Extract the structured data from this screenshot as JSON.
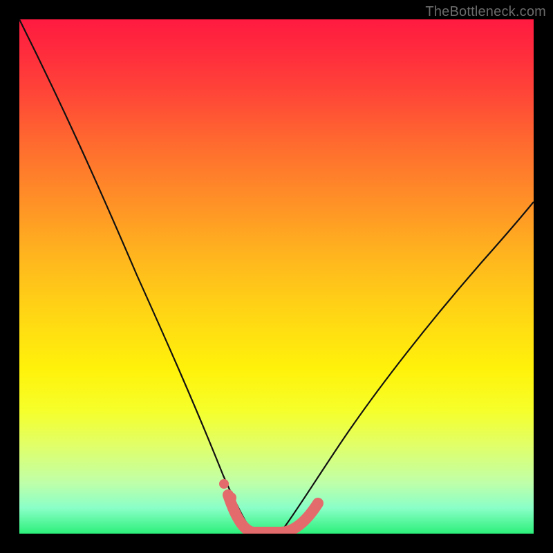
{
  "watermark": "TheBottleneck.com",
  "colors": {
    "page_bg": "#000000",
    "curve": "#1a1a1a",
    "dip_marker": "#e46b6b",
    "gradient_top": "#ff1a40",
    "gradient_mid": "#ffe500",
    "gradient_bottom": "#2cf07a"
  },
  "chart_data": {
    "type": "line",
    "title": "",
    "xlabel": "",
    "ylabel": "",
    "xlim": [
      0,
      100
    ],
    "ylim": [
      0,
      100
    ],
    "series": [
      {
        "name": "left-curve",
        "x": [
          0,
          5,
          10,
          15,
          20,
          25,
          30,
          34,
          37,
          39,
          41,
          43,
          45
        ],
        "values": [
          100,
          90,
          79,
          67,
          55,
          43,
          31,
          21,
          13,
          8,
          4,
          1,
          0
        ]
      },
      {
        "name": "right-curve",
        "x": [
          50,
          52,
          55,
          58,
          62,
          67,
          73,
          80,
          88,
          95,
          100
        ],
        "values": [
          0,
          1,
          3,
          6,
          11,
          18,
          27,
          37,
          48,
          55,
          60
        ]
      },
      {
        "name": "dip-markers",
        "x": [
          41,
          43,
          45,
          47,
          49,
          51,
          53,
          55,
          57
        ],
        "values": [
          4,
          1,
          0,
          0,
          0,
          0,
          1,
          3,
          6
        ]
      }
    ],
    "annotations": []
  }
}
